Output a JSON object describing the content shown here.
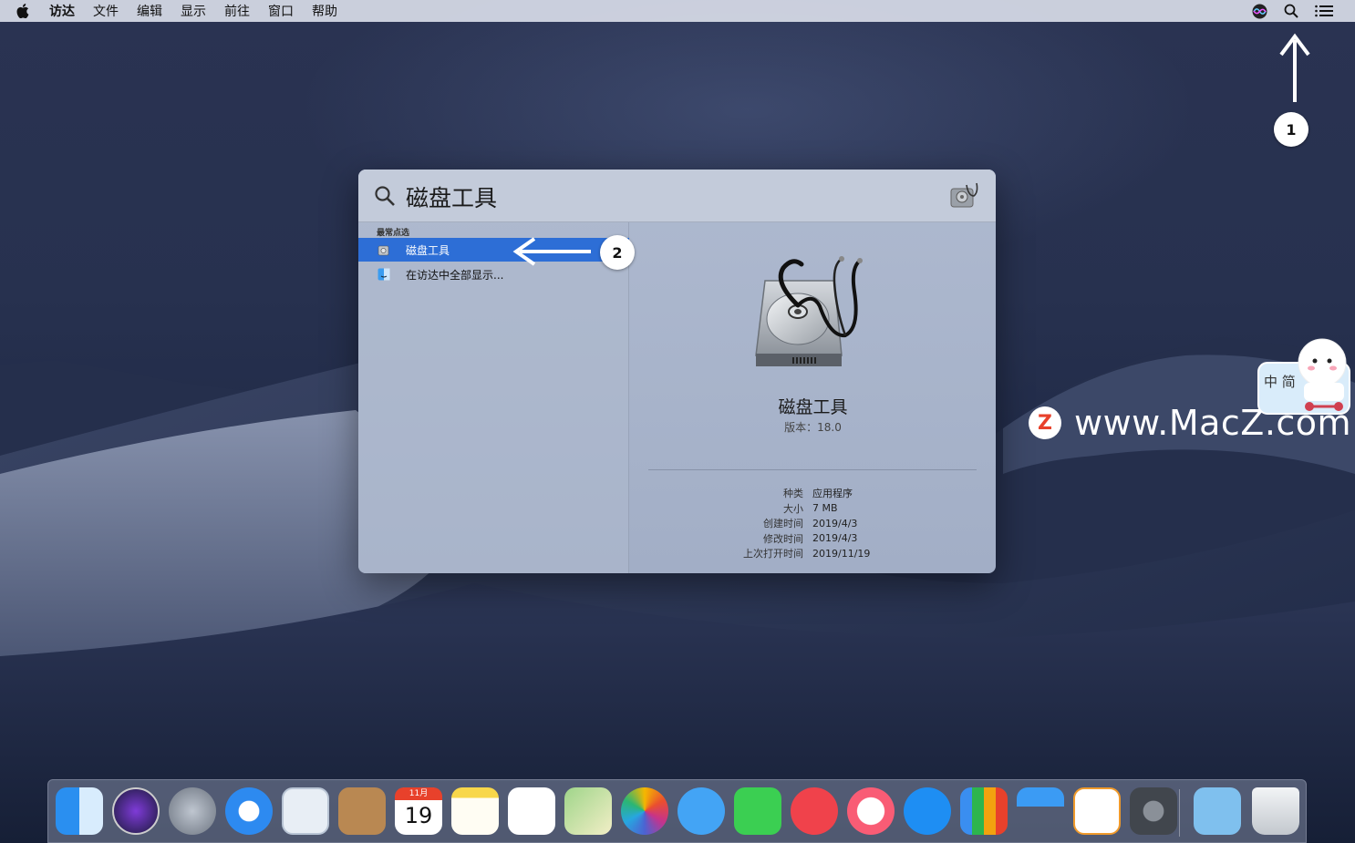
{
  "menubar": {
    "app_name": "访达",
    "items": [
      "文件",
      "编辑",
      "显示",
      "前往",
      "窗口",
      "帮助"
    ]
  },
  "annotations": {
    "badge1": "1",
    "badge2": "2"
  },
  "spotlight": {
    "query": "磁盘工具",
    "section_label": "最常点选",
    "results": [
      {
        "label": "磁盘工具",
        "selected": true
      },
      {
        "label": "在访达中全部显示..."
      }
    ],
    "preview": {
      "title": "磁盘工具",
      "version": "版本：18.0",
      "meta": [
        {
          "key": "种类",
          "value": "应用程序"
        },
        {
          "key": "大小",
          "value": "7 MB"
        },
        {
          "key": "创建时间",
          "value": "2019/4/3"
        },
        {
          "key": "修改时间",
          "value": "2019/4/3"
        },
        {
          "key": "上次打开时间",
          "value": "2019/11/19"
        }
      ]
    }
  },
  "watermark": {
    "logo_letter": "Z",
    "text": "www.MacZ.com",
    "sticker_text": "中 简"
  },
  "dock": {
    "calendar_month": "11月",
    "calendar_day": "19",
    "apps": [
      "finder-icon",
      "siri-icon",
      "launchpad-icon",
      "safari-icon",
      "mail-icon",
      "contacts-icon",
      "calendar-icon",
      "notes-icon",
      "reminders-icon",
      "maps-icon",
      "photos-icon",
      "messages-icon",
      "facetime-icon",
      "news-icon",
      "music-icon",
      "app-store-icon",
      "numbers-icon",
      "keynote-icon",
      "pages-icon",
      "system-preferences-icon",
      "downloads-folder-icon",
      "trash-icon"
    ]
  },
  "colors": {
    "selection": "#2d6ed6",
    "menubar": "#d8dce8"
  }
}
